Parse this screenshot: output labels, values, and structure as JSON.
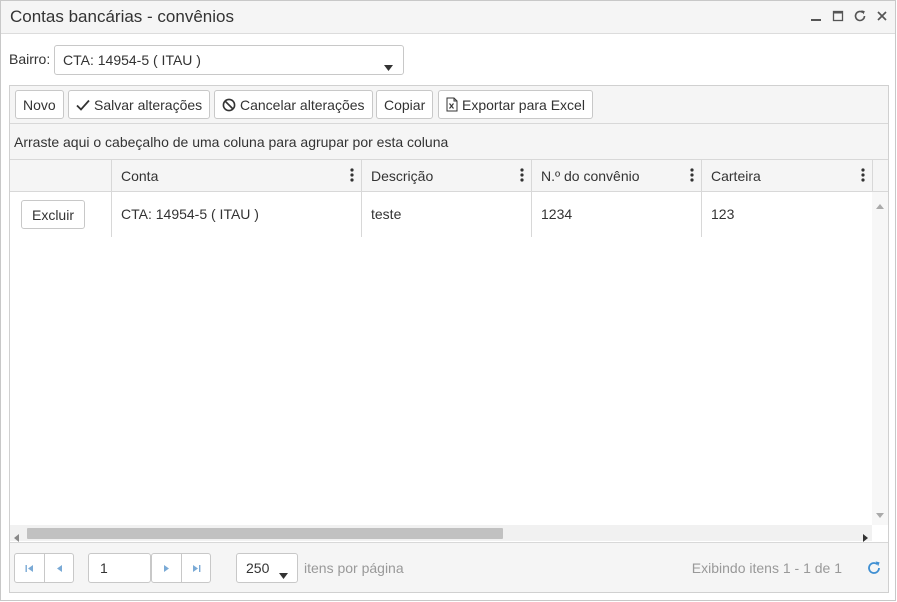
{
  "window": {
    "title": "Contas bancárias - convênios"
  },
  "filter": {
    "label": "Bairro:",
    "value": "CTA: 14954-5 ( ITAU )"
  },
  "toolbar": {
    "new_label": "Novo",
    "save_label": "Salvar alterações",
    "cancel_label": "Cancelar alterações",
    "copy_label": "Copiar",
    "export_label": "Exportar para Excel"
  },
  "grid": {
    "group_hint": "Arraste aqui o cabeçalho de uma coluna para agrupar por esta coluna",
    "columns": [
      "Conta",
      "Descrição",
      "N.º do convênio",
      "Carteira"
    ],
    "rows": [
      {
        "action": "Excluir",
        "conta": "CTA: 14954-5 ( ITAU )",
        "descricao": "teste",
        "convenio": "1234",
        "carteira": "123"
      }
    ]
  },
  "pager": {
    "page": "1",
    "page_size": "250",
    "page_size_label": "itens por página",
    "info": "Exibindo itens 1 - 1 de 1"
  },
  "icons": {
    "minimize": "minimize-icon",
    "maximize": "maximize-icon",
    "refresh": "refresh-icon",
    "close": "close-icon",
    "save": "check-icon",
    "cancel": "cancel-icon",
    "export": "excel-icon",
    "column_menu": "more-vertical-icon"
  },
  "colors": {
    "accent": "#3f8fd2",
    "border": "#c8c8c8",
    "panel": "#f5f5f5"
  }
}
